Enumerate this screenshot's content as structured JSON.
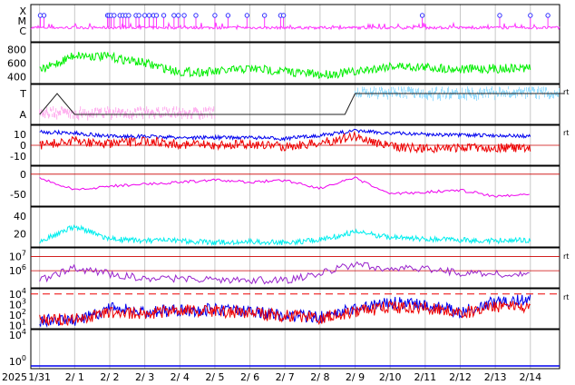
{
  "chart_data": [
    {
      "type": "scatter",
      "title": "",
      "xlabel": "",
      "ylabel": "",
      "y_categories": [
        "X",
        "M",
        "C"
      ],
      "x": [
        "2025-01-31",
        "2025-02-01",
        "2025-02-02",
        "2025-02-03",
        "2025-02-04",
        "2025-02-05",
        "2025-02-06",
        "2025-02-07",
        "2025-02-08",
        "2025-02-09",
        "2025-02-10",
        "2025-02-11",
        "2025-02-12",
        "2025-02-13",
        "2025-02-14"
      ],
      "series": [
        {
          "marker": "circle",
          "color": "#3333ff",
          "x": [
            "2025-01-31T00:30",
            "2025-01-31T03:00",
            "2025-02-01T22:30",
            "2025-02-01T23:30",
            "2025-02-02T01:00",
            "2025-02-02T03:00",
            "2025-02-02T07:00",
            "2025-02-02T09:00",
            "2025-02-02T11:00",
            "2025-02-02T13:00",
            "2025-02-02T18:00",
            "2025-02-02T20:00",
            "2025-02-03T00:00",
            "2025-02-03T03:00",
            "2025-02-03T06:00",
            "2025-02-03T08:00",
            "2025-02-03T13:00",
            "2025-02-03T20:00",
            "2025-02-03T23:00",
            "2025-02-04T03:00",
            "2025-02-04T11:00",
            "2025-02-05T00:00",
            "2025-02-05T09:00",
            "2025-02-05T22:00",
            "2025-02-06T10:00",
            "2025-02-06T21:00",
            "2025-02-06T23:00",
            "2025-02-10T22:00",
            "2025-02-13T03:00",
            "2025-02-14T00:00",
            "2025-02-14T12:00"
          ],
          "y": [
            1.2,
            1.2,
            1.2,
            1.2,
            1.2,
            1.2,
            1.2,
            1.2,
            1.2,
            1.2,
            1.2,
            1.2,
            1.2,
            1.2,
            1.2,
            1.2,
            1.2,
            1.2,
            1.2,
            1.2,
            1.2,
            1.2,
            1.2,
            1.2,
            1.2,
            1.2,
            1.2,
            1.2,
            1.2,
            1.2,
            1.2
          ]
        },
        {
          "line": true,
          "color": "#ff33ff",
          "y_range": "C"
        }
      ]
    },
    {
      "type": "line",
      "yticks": [
        400,
        600,
        800
      ],
      "ylim": [
        300,
        900
      ],
      "series": [
        {
          "color": "#00ee00",
          "x": [
            "2025-01-31",
            "2025-02-01",
            "2025-02-02",
            "2025-02-03",
            "2025-02-04",
            "2025-02-05",
            "2025-02-06",
            "2025-02-07",
            "2025-02-08",
            "2025-02-09",
            "2025-02-10",
            "2025-02-11",
            "2025-02-12",
            "2025-02-13",
            "2025-02-14"
          ],
          "y": [
            480,
            720,
            690,
            600,
            470,
            470,
            520,
            480,
            430,
            470,
            560,
            540,
            510,
            520,
            530
          ]
        }
      ]
    },
    {
      "type": "line",
      "y_categories": [
        "T",
        "A"
      ],
      "right_label": "rt",
      "series": [
        {
          "color": "#222222",
          "x": [
            "2025-01-31",
            "2025-01-31T12:00",
            "2025-02-01",
            "2025-02-08T17:00",
            "2025-02-09",
            "2025-02-14T23:00"
          ],
          "y": [
            "A",
            "T",
            "A",
            "A",
            "T",
            "T"
          ]
        },
        {
          "color": "#99ddff",
          "x": [
            "2025-02-09",
            "2025-02-14T23:00"
          ],
          "y": [
            "T",
            "T"
          ]
        },
        {
          "color": "#ffaaee",
          "x": [
            "2025-01-31",
            "2025-02-05"
          ],
          "y": [
            "A",
            "A"
          ]
        }
      ]
    },
    {
      "type": "line",
      "yticks": [
        -10,
        0,
        10
      ],
      "ylim": [
        -18,
        18
      ],
      "right_label": "rt",
      "series": [
        {
          "color": "#0000ee",
          "x": [
            "2025-01-31",
            "2025-02-01",
            "2025-02-02",
            "2025-02-03",
            "2025-02-04",
            "2025-02-05",
            "2025-02-06",
            "2025-02-07",
            "2025-02-08",
            "2025-02-09",
            "2025-02-10",
            "2025-02-11",
            "2025-02-12",
            "2025-02-13",
            "2025-02-14"
          ],
          "y": [
            12,
            11,
            8,
            8,
            7,
            7,
            7,
            6,
            9,
            13,
            11,
            10,
            9,
            9,
            8
          ]
        },
        {
          "color": "#ee0000",
          "x": [
            "2025-01-31",
            "2025-02-01",
            "2025-02-02",
            "2025-02-03",
            "2025-02-04",
            "2025-02-05",
            "2025-02-06",
            "2025-02-07",
            "2025-02-08",
            "2025-02-09",
            "2025-02-10",
            "2025-02-11",
            "2025-02-12",
            "2025-02-13",
            "2025-02-14"
          ],
          "y": [
            0,
            4,
            1,
            4,
            1,
            0,
            1,
            -1,
            2,
            8,
            -1,
            -3,
            -2,
            -2,
            -3
          ]
        }
      ]
    },
    {
      "type": "line",
      "yticks": [
        -50,
        0
      ],
      "ylim": [
        -80,
        20
      ],
      "series": [
        {
          "color": "#ee00ee",
          "x": [
            "2025-01-31",
            "2025-02-01",
            "2025-02-02",
            "2025-02-03",
            "2025-02-04",
            "2025-02-05",
            "2025-02-06",
            "2025-02-07",
            "2025-02-08",
            "2025-02-09",
            "2025-02-10",
            "2025-02-11",
            "2025-02-12",
            "2025-02-13",
            "2025-02-14"
          ],
          "y": [
            -10,
            -40,
            -30,
            -25,
            -20,
            -15,
            -20,
            -15,
            -35,
            -10,
            -50,
            -45,
            -40,
            -55,
            -50
          ]
        }
      ]
    },
    {
      "type": "line",
      "yticks": [
        20,
        40
      ],
      "ylim": [
        5,
        50
      ],
      "series": [
        {
          "color": "#00eeee",
          "x": [
            "2025-01-31",
            "2025-02-01",
            "2025-02-02",
            "2025-02-03",
            "2025-02-04",
            "2025-02-05",
            "2025-02-06",
            "2025-02-07",
            "2025-02-08",
            "2025-02-09",
            "2025-02-10",
            "2025-02-11",
            "2025-02-12",
            "2025-02-13",
            "2025-02-14"
          ],
          "y": [
            12,
            28,
            14,
            12,
            12,
            10,
            11,
            10,
            13,
            22,
            16,
            14,
            13,
            12,
            13
          ]
        }
      ]
    },
    {
      "type": "line",
      "log_scale": true,
      "ytick_labels": [
        "10^6",
        "10^7"
      ],
      "right_label": "rt",
      "series": [
        {
          "color": "#9922cc",
          "x": [
            "2025-01-31",
            "2025-02-01",
            "2025-02-02",
            "2025-02-03",
            "2025-02-07",
            "2025-02-08",
            "2025-02-09",
            "2025-02-10",
            "2025-02-11",
            "2025-02-12",
            "2025-02-13",
            "2025-02-14"
          ],
          "y": [
            200000,
            1500000,
            600000,
            300000,
            200000,
            600000,
            3000000,
            1200000,
            1500000,
            700000,
            600000,
            500000
          ]
        }
      ]
    },
    {
      "type": "line",
      "log_scale": true,
      "ytick_labels": [
        "10^1",
        "10^2",
        "10^3",
        "10^4"
      ],
      "right_label": "rt",
      "series": [
        {
          "color": "#0000ee",
          "x": [
            "2025-01-31",
            "2025-02-01",
            "2025-02-02",
            "2025-02-03",
            "2025-02-04",
            "2025-02-05",
            "2025-02-06",
            "2025-02-07",
            "2025-02-08",
            "2025-02-09",
            "2025-02-10",
            "2025-02-11",
            "2025-02-12",
            "2025-02-13",
            "2025-02-14"
          ],
          "y": [
            30,
            25,
            400,
            200,
            300,
            300,
            200,
            100,
            60,
            400,
            1500,
            1000,
            200,
            2000,
            3000
          ]
        },
        {
          "color": "#ee0000",
          "x": [
            "2025-01-31",
            "2025-02-01",
            "2025-02-02",
            "2025-02-03",
            "2025-02-04",
            "2025-02-05",
            "2025-02-06",
            "2025-02-07",
            "2025-02-08",
            "2025-02-09",
            "2025-02-10",
            "2025-02-11",
            "2025-02-12",
            "2025-02-13",
            "2025-02-14"
          ],
          "y": [
            40,
            40,
            200,
            150,
            250,
            250,
            150,
            80,
            50,
            200,
            600,
            500,
            150,
            600,
            800
          ]
        },
        {
          "color": "#ee0000",
          "dashed": true,
          "y": 10000
        }
      ]
    },
    {
      "type": "line",
      "log_scale": true,
      "ytick_labels": [
        "10^0",
        "10^4"
      ],
      "series": [
        {
          "color": "#0000ee",
          "x": [
            "2025-01-31",
            "2025-02-14"
          ],
          "y": [
            1,
            1
          ]
        }
      ]
    }
  ],
  "x_axis": {
    "year_label": "2025",
    "tick_labels": [
      "1/31",
      "2/ 1",
      "2/ 2",
      "2/ 3",
      "2/ 4",
      "2/ 5",
      "2/ 6",
      "2/ 7",
      "2/ 8",
      "2/ 9",
      "2/10",
      "2/11",
      "2/12",
      "2/13",
      "2/14"
    ]
  }
}
